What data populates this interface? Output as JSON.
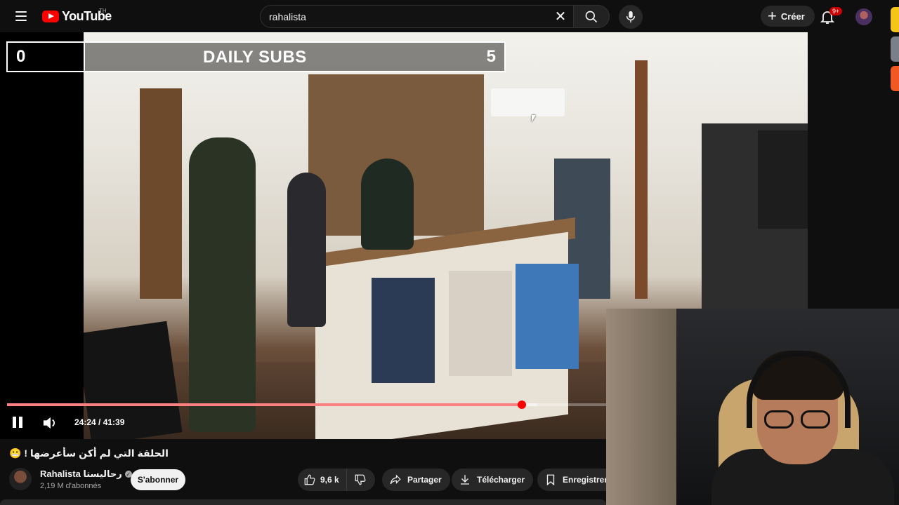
{
  "header": {
    "logo_text": "YouTube",
    "country_code": "TH",
    "search_value": "rahalista",
    "create_label": "Créer",
    "notif_count": "9+"
  },
  "overlay": {
    "left_value": "0",
    "title": "DAILY SUBS",
    "right_value": "5"
  },
  "player": {
    "time": "24:24 / 41:39",
    "progress_fraction": 0.859,
    "buffer_fraction": 0.885
  },
  "video": {
    "title": "😬 ! الحلقة التي لم أكن سأعرضها",
    "channel_name": "Rahalista رحاليستا",
    "subscribers": "2,19 M d'abonnés",
    "subscribe_label": "S'abonner",
    "likes": "9,6 k",
    "share_label": "Partager",
    "download_label": "Télécharger",
    "save_label": "Enregistrer"
  },
  "colors": {
    "accent": "#ff0000",
    "side_icons": [
      "#f5c518",
      "#7a7f8a",
      "#f05a22"
    ]
  }
}
